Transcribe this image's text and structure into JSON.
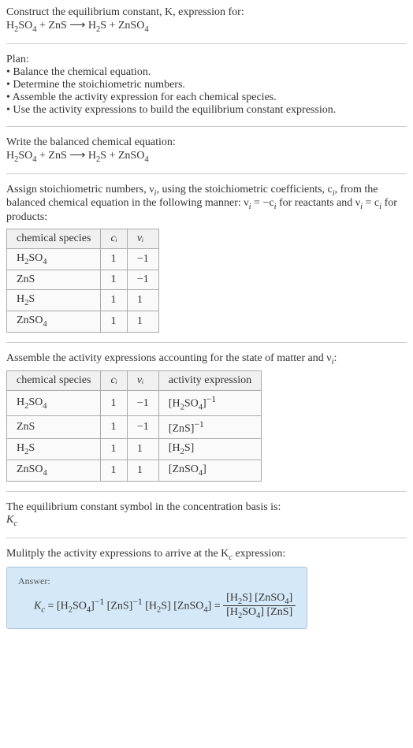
{
  "header": {
    "prompt": "Construct the equilibrium constant, K, expression for:",
    "equation_lhs1": "H",
    "equation_lhs1_sub1": "2",
    "equation_lhs1_mid": "SO",
    "equation_lhs1_sub2": "4",
    "plus1": " + ZnS ⟶ H",
    "rhs_sub1": "2",
    "rhs_mid": "S + ZnSO",
    "rhs_sub2": "4"
  },
  "plan": {
    "title": "Plan:",
    "b1": "• Balance the chemical equation.",
    "b2": "• Determine the stoichiometric numbers.",
    "b3": "• Assemble the activity expression for each chemical species.",
    "b4": "• Use the activity expressions to build the equilibrium constant expression."
  },
  "balanced": {
    "title": "Write the balanced chemical equation:",
    "eq_l1": "H",
    "eq_l1s1": "2",
    "eq_l1m": "SO",
    "eq_l1s2": "4",
    "eq_plus": " + ZnS ⟶ H",
    "eq_r1s": "2",
    "eq_r1m": "S + ZnSO",
    "eq_r2s": "4"
  },
  "assign": {
    "text1": "Assign stoichiometric numbers, ν",
    "sub_i1": "i",
    "text2": ", using the stoichiometric coefficients, c",
    "sub_i2": "i",
    "text3": ", from the balanced chemical equation in the following manner: ν",
    "sub_i3": "i",
    "text4": " = −c",
    "sub_i4": "i",
    "text5": " for reactants and ν",
    "sub_i5": "i",
    "text6": " = c",
    "sub_i6": "i",
    "text7": " for products:"
  },
  "table1": {
    "h1": "chemical species",
    "h2": "cᵢ",
    "h3": "νᵢ",
    "rows": [
      {
        "sp_pre": "H",
        "sp_s1": "2",
        "sp_mid": "SO",
        "sp_s2": "4",
        "c": "1",
        "v": "−1"
      },
      {
        "sp_pre": "ZnS",
        "sp_s1": "",
        "sp_mid": "",
        "sp_s2": "",
        "c": "1",
        "v": "−1"
      },
      {
        "sp_pre": "H",
        "sp_s1": "2",
        "sp_mid": "S",
        "sp_s2": "",
        "c": "1",
        "v": "1"
      },
      {
        "sp_pre": "ZnSO",
        "sp_s1": "4",
        "sp_mid": "",
        "sp_s2": "",
        "c": "1",
        "v": "1"
      }
    ]
  },
  "assemble": {
    "text1": "Assemble the activity expressions accounting for the state of matter and ν",
    "sub_i": "i",
    "text2": ":"
  },
  "table2": {
    "h1": "chemical species",
    "h2": "cᵢ",
    "h3": "νᵢ",
    "h4": "activity expression",
    "rows": [
      {
        "sp_pre": "H",
        "sp_s1": "2",
        "sp_mid": "SO",
        "sp_s2": "4",
        "c": "1",
        "v": "−1",
        "ae_pre": "[H",
        "ae_s1": "2",
        "ae_mid": "SO",
        "ae_s2": "4",
        "ae_post": "]",
        "ae_sup": "−1"
      },
      {
        "sp_pre": "ZnS",
        "sp_s1": "",
        "sp_mid": "",
        "sp_s2": "",
        "c": "1",
        "v": "−1",
        "ae_pre": "[ZnS]",
        "ae_s1": "",
        "ae_mid": "",
        "ae_s2": "",
        "ae_post": "",
        "ae_sup": "−1"
      },
      {
        "sp_pre": "H",
        "sp_s1": "2",
        "sp_mid": "S",
        "sp_s2": "",
        "c": "1",
        "v": "1",
        "ae_pre": "[H",
        "ae_s1": "2",
        "ae_mid": "S]",
        "ae_s2": "",
        "ae_post": "",
        "ae_sup": ""
      },
      {
        "sp_pre": "ZnSO",
        "sp_s1": "4",
        "sp_mid": "",
        "sp_s2": "",
        "c": "1",
        "v": "1",
        "ae_pre": "[ZnSO",
        "ae_s1": "4",
        "ae_mid": "]",
        "ae_s2": "",
        "ae_post": "",
        "ae_sup": ""
      }
    ]
  },
  "eqsymbol": {
    "line1": "The equilibrium constant symbol in the concentration basis is:",
    "line2_pre": "K",
    "line2_sub": "c"
  },
  "multiply": {
    "text1": "Mulitply the activity expressions to arrive at the K",
    "sub_c": "c",
    "text2": " expression:"
  },
  "answer": {
    "label": "Answer:",
    "Kc_pre": "K",
    "Kc_sub": "c",
    "eq": " = [H",
    "s1": "2",
    "m1": "SO",
    "s2": "4",
    "b1": "]",
    "sup1": "−1",
    "sp1": " [ZnS]",
    "sup2": "−1",
    "sp2": " [H",
    "s3": "2",
    "m2": "S] [ZnSO",
    "s4": "4",
    "b2": "] = ",
    "num_pre": "[H",
    "num_s1": "2",
    "num_m1": "S] [ZnSO",
    "num_s2": "4",
    "num_post": "]",
    "den_pre": "[H",
    "den_s1": "2",
    "den_m1": "SO",
    "den_s2": "4",
    "den_post": "] [ZnS]"
  }
}
